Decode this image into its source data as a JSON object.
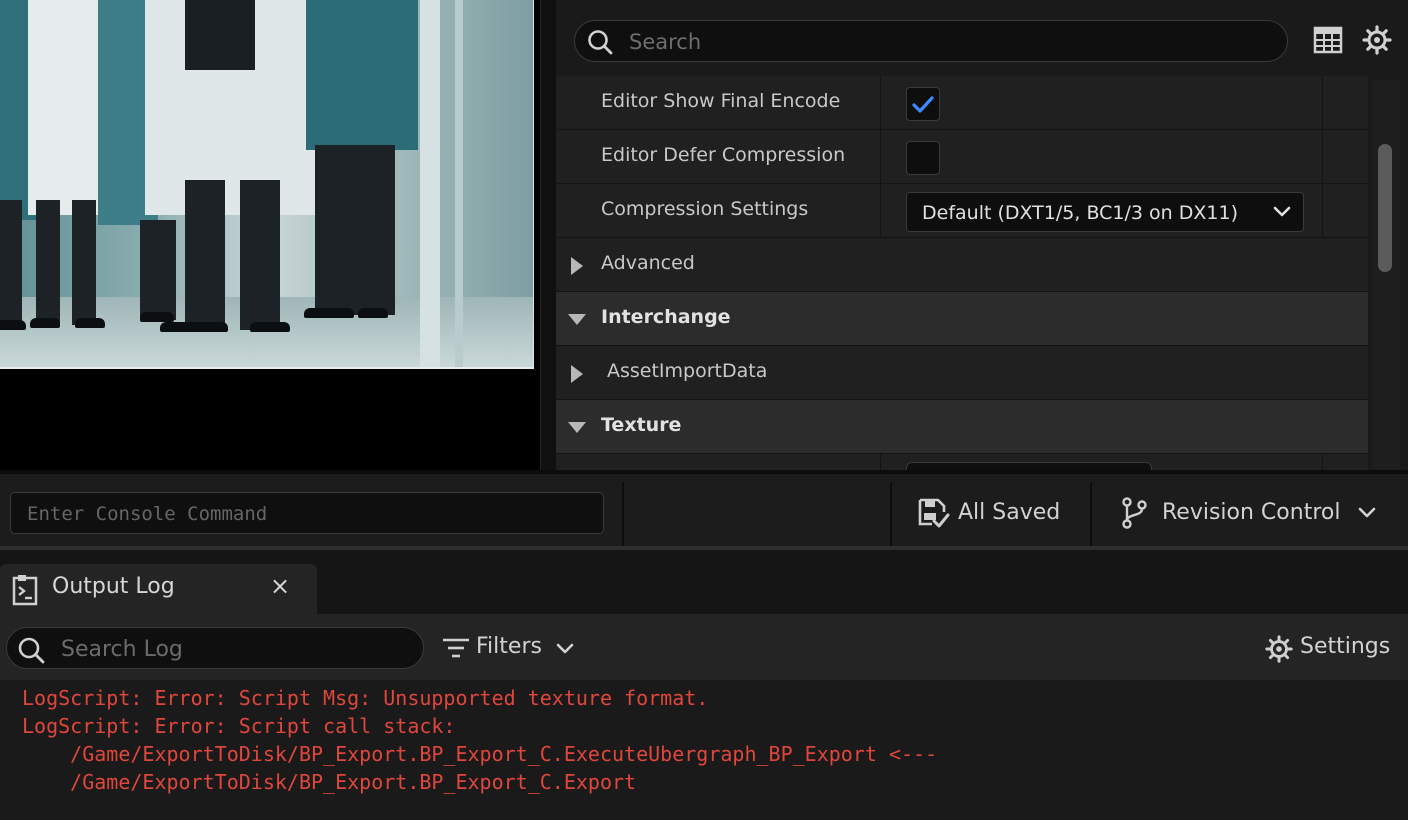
{
  "details": {
    "search_placeholder": "Search",
    "toolbar_icons": [
      "table-view-icon",
      "gear-icon"
    ],
    "rows": [
      {
        "label": "Editor Show Final Encode",
        "type": "checkbox",
        "checked": true
      },
      {
        "label": "Editor Defer Compression",
        "type": "checkbox",
        "checked": false
      },
      {
        "label": "Compression Settings",
        "type": "combo",
        "value": "Default (DXT1/5, BC1/3 on DX11)"
      },
      {
        "label": "Advanced",
        "type": "subgroup",
        "expanded": false
      },
      {
        "label": "Interchange",
        "type": "category",
        "expanded": true
      },
      {
        "label": "AssetImportData",
        "type": "subgroup",
        "expanded": false
      },
      {
        "label": "Texture",
        "type": "category",
        "expanded": true
      }
    ]
  },
  "status_bar": {
    "console_placeholder": "Enter Console Command",
    "all_saved": "All Saved",
    "revision_control": "Revision Control"
  },
  "output_log": {
    "tab_title": "Output Log",
    "close_glyph": "×",
    "search_placeholder": "Search Log",
    "filters_label": "Filters",
    "settings_label": "Settings",
    "lines": [
      "LogScript: Error: Script Msg: Unsupported texture format.",
      "LogScript: Error: Script call stack:",
      "    /Game/ExportToDisk/BP_Export.BP_Export_C.ExecuteUbergraph_BP_Export <---",
      "    /Game/ExportToDisk/BP_Export.BP_Export_C.Export"
    ],
    "error_color": "#e0463c"
  },
  "colors": {
    "panel_bg": "#1a1a1a",
    "checkbox_accent": "#3d8bff"
  }
}
